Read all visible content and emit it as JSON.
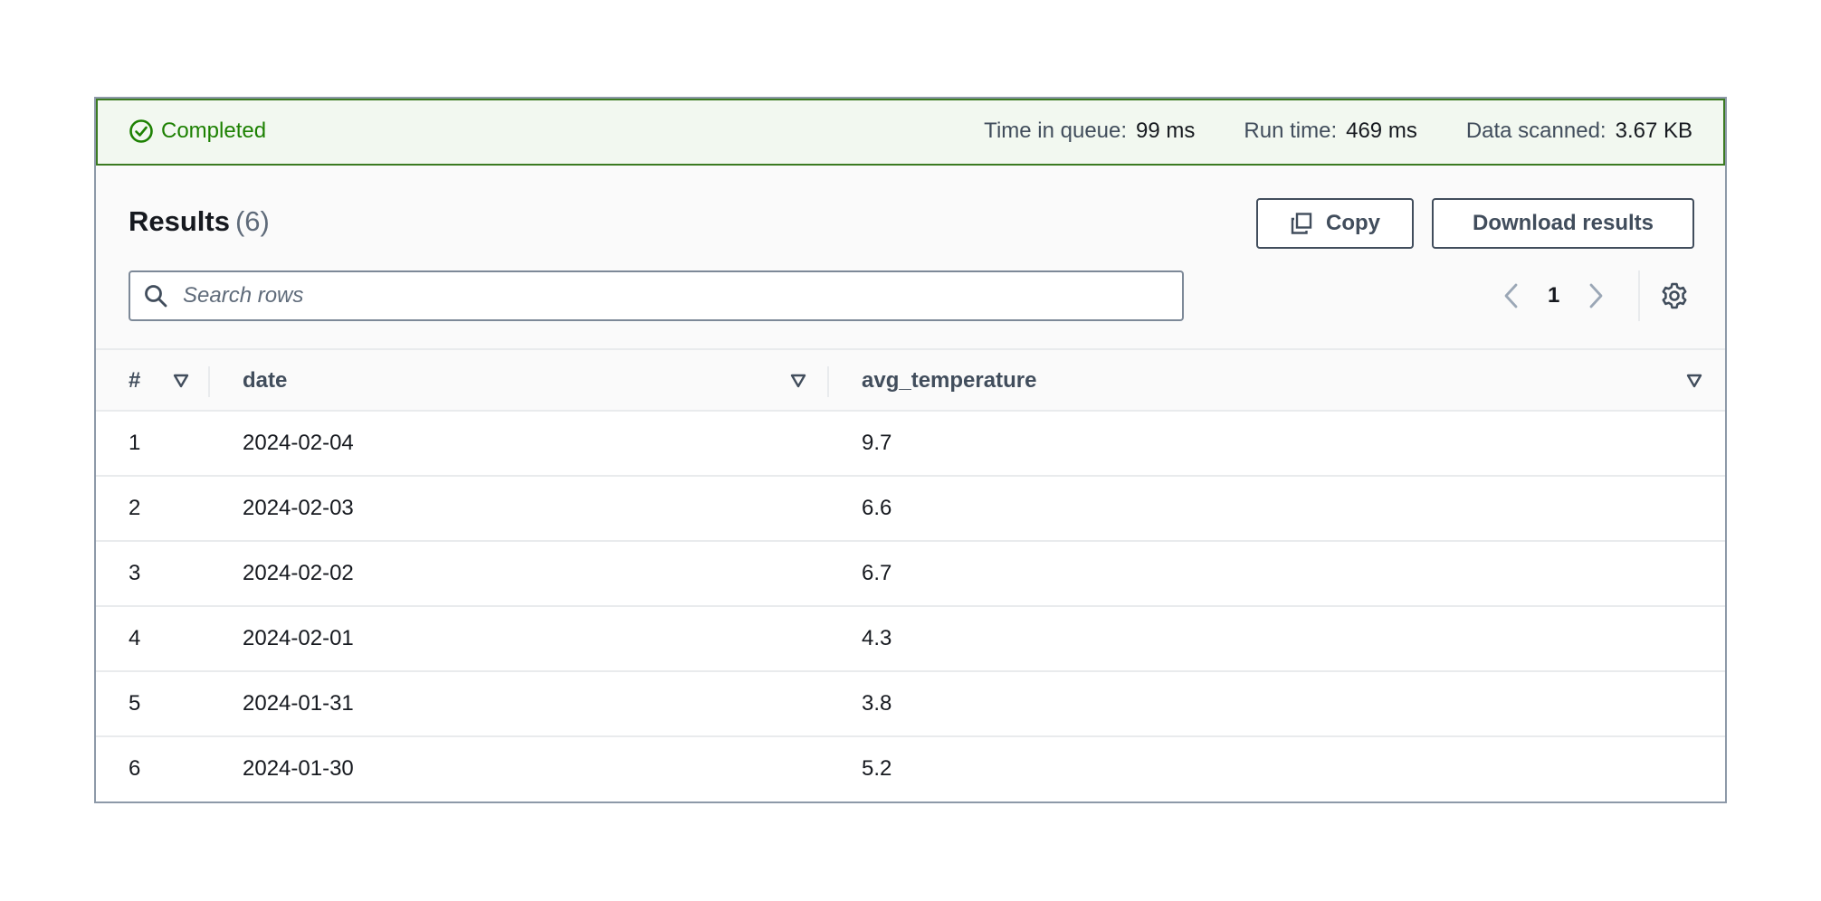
{
  "status": {
    "label": "Completed",
    "color": "#1d8102",
    "icon": "check-circle-icon",
    "metrics": [
      {
        "label": "Time in queue:",
        "value": "99 ms"
      },
      {
        "label": "Run time:",
        "value": "469 ms"
      },
      {
        "label": "Data scanned:",
        "value": "3.67 KB"
      }
    ]
  },
  "results": {
    "title": "Results",
    "count": "(6)",
    "copy_label": "Copy",
    "download_label": "Download results"
  },
  "search": {
    "placeholder": "Search rows",
    "value": ""
  },
  "pagination": {
    "current_page": "1"
  },
  "table": {
    "columns": [
      "#",
      "date",
      "avg_temperature"
    ],
    "rows": [
      {
        "num": "1",
        "date": "2024-02-04",
        "avg_temperature": "9.7"
      },
      {
        "num": "2",
        "date": "2024-02-03",
        "avg_temperature": "6.6"
      },
      {
        "num": "3",
        "date": "2024-02-02",
        "avg_temperature": "6.7"
      },
      {
        "num": "4",
        "date": "2024-02-01",
        "avg_temperature": "4.3"
      },
      {
        "num": "5",
        "date": "2024-01-31",
        "avg_temperature": "3.8"
      },
      {
        "num": "6",
        "date": "2024-01-30",
        "avg_temperature": "5.2"
      }
    ]
  }
}
